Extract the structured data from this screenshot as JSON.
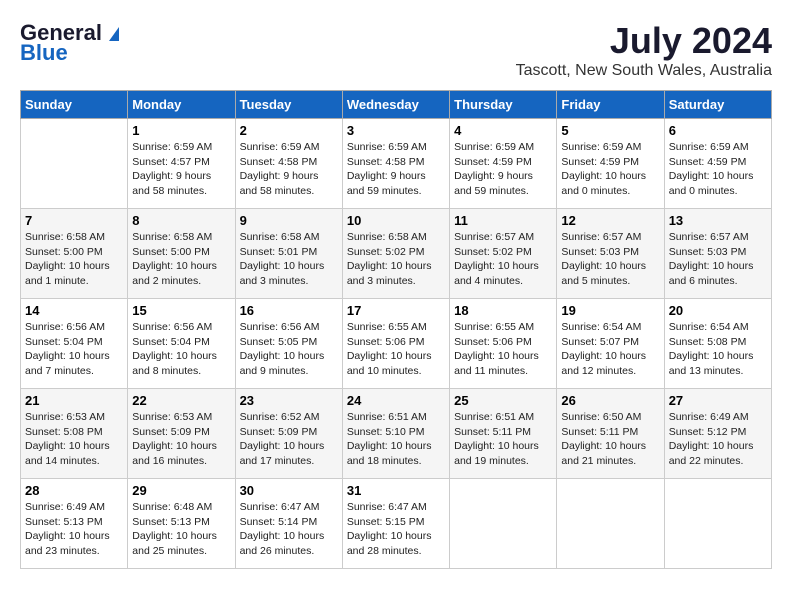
{
  "header": {
    "logo_general": "General",
    "logo_blue": "Blue",
    "month": "July 2024",
    "location": "Tascott, New South Wales, Australia"
  },
  "days_of_week": [
    "Sunday",
    "Monday",
    "Tuesday",
    "Wednesday",
    "Thursday",
    "Friday",
    "Saturday"
  ],
  "weeks": [
    [
      {
        "day": "",
        "info": ""
      },
      {
        "day": "1",
        "info": "Sunrise: 6:59 AM\nSunset: 4:57 PM\nDaylight: 9 hours\nand 58 minutes."
      },
      {
        "day": "2",
        "info": "Sunrise: 6:59 AM\nSunset: 4:58 PM\nDaylight: 9 hours\nand 58 minutes."
      },
      {
        "day": "3",
        "info": "Sunrise: 6:59 AM\nSunset: 4:58 PM\nDaylight: 9 hours\nand 59 minutes."
      },
      {
        "day": "4",
        "info": "Sunrise: 6:59 AM\nSunset: 4:59 PM\nDaylight: 9 hours\nand 59 minutes."
      },
      {
        "day": "5",
        "info": "Sunrise: 6:59 AM\nSunset: 4:59 PM\nDaylight: 10 hours\nand 0 minutes."
      },
      {
        "day": "6",
        "info": "Sunrise: 6:59 AM\nSunset: 4:59 PM\nDaylight: 10 hours\nand 0 minutes."
      }
    ],
    [
      {
        "day": "7",
        "info": "Sunrise: 6:58 AM\nSunset: 5:00 PM\nDaylight: 10 hours\nand 1 minute."
      },
      {
        "day": "8",
        "info": "Sunrise: 6:58 AM\nSunset: 5:00 PM\nDaylight: 10 hours\nand 2 minutes."
      },
      {
        "day": "9",
        "info": "Sunrise: 6:58 AM\nSunset: 5:01 PM\nDaylight: 10 hours\nand 3 minutes."
      },
      {
        "day": "10",
        "info": "Sunrise: 6:58 AM\nSunset: 5:02 PM\nDaylight: 10 hours\nand 3 minutes."
      },
      {
        "day": "11",
        "info": "Sunrise: 6:57 AM\nSunset: 5:02 PM\nDaylight: 10 hours\nand 4 minutes."
      },
      {
        "day": "12",
        "info": "Sunrise: 6:57 AM\nSunset: 5:03 PM\nDaylight: 10 hours\nand 5 minutes."
      },
      {
        "day": "13",
        "info": "Sunrise: 6:57 AM\nSunset: 5:03 PM\nDaylight: 10 hours\nand 6 minutes."
      }
    ],
    [
      {
        "day": "14",
        "info": "Sunrise: 6:56 AM\nSunset: 5:04 PM\nDaylight: 10 hours\nand 7 minutes."
      },
      {
        "day": "15",
        "info": "Sunrise: 6:56 AM\nSunset: 5:04 PM\nDaylight: 10 hours\nand 8 minutes."
      },
      {
        "day": "16",
        "info": "Sunrise: 6:56 AM\nSunset: 5:05 PM\nDaylight: 10 hours\nand 9 minutes."
      },
      {
        "day": "17",
        "info": "Sunrise: 6:55 AM\nSunset: 5:06 PM\nDaylight: 10 hours\nand 10 minutes."
      },
      {
        "day": "18",
        "info": "Sunrise: 6:55 AM\nSunset: 5:06 PM\nDaylight: 10 hours\nand 11 minutes."
      },
      {
        "day": "19",
        "info": "Sunrise: 6:54 AM\nSunset: 5:07 PM\nDaylight: 10 hours\nand 12 minutes."
      },
      {
        "day": "20",
        "info": "Sunrise: 6:54 AM\nSunset: 5:08 PM\nDaylight: 10 hours\nand 13 minutes."
      }
    ],
    [
      {
        "day": "21",
        "info": "Sunrise: 6:53 AM\nSunset: 5:08 PM\nDaylight: 10 hours\nand 14 minutes."
      },
      {
        "day": "22",
        "info": "Sunrise: 6:53 AM\nSunset: 5:09 PM\nDaylight: 10 hours\nand 16 minutes."
      },
      {
        "day": "23",
        "info": "Sunrise: 6:52 AM\nSunset: 5:09 PM\nDaylight: 10 hours\nand 17 minutes."
      },
      {
        "day": "24",
        "info": "Sunrise: 6:51 AM\nSunset: 5:10 PM\nDaylight: 10 hours\nand 18 minutes."
      },
      {
        "day": "25",
        "info": "Sunrise: 6:51 AM\nSunset: 5:11 PM\nDaylight: 10 hours\nand 19 minutes."
      },
      {
        "day": "26",
        "info": "Sunrise: 6:50 AM\nSunset: 5:11 PM\nDaylight: 10 hours\nand 21 minutes."
      },
      {
        "day": "27",
        "info": "Sunrise: 6:49 AM\nSunset: 5:12 PM\nDaylight: 10 hours\nand 22 minutes."
      }
    ],
    [
      {
        "day": "28",
        "info": "Sunrise: 6:49 AM\nSunset: 5:13 PM\nDaylight: 10 hours\nand 23 minutes."
      },
      {
        "day": "29",
        "info": "Sunrise: 6:48 AM\nSunset: 5:13 PM\nDaylight: 10 hours\nand 25 minutes."
      },
      {
        "day": "30",
        "info": "Sunrise: 6:47 AM\nSunset: 5:14 PM\nDaylight: 10 hours\nand 26 minutes."
      },
      {
        "day": "31",
        "info": "Sunrise: 6:47 AM\nSunset: 5:15 PM\nDaylight: 10 hours\nand 28 minutes."
      },
      {
        "day": "",
        "info": ""
      },
      {
        "day": "",
        "info": ""
      },
      {
        "day": "",
        "info": ""
      }
    ]
  ]
}
